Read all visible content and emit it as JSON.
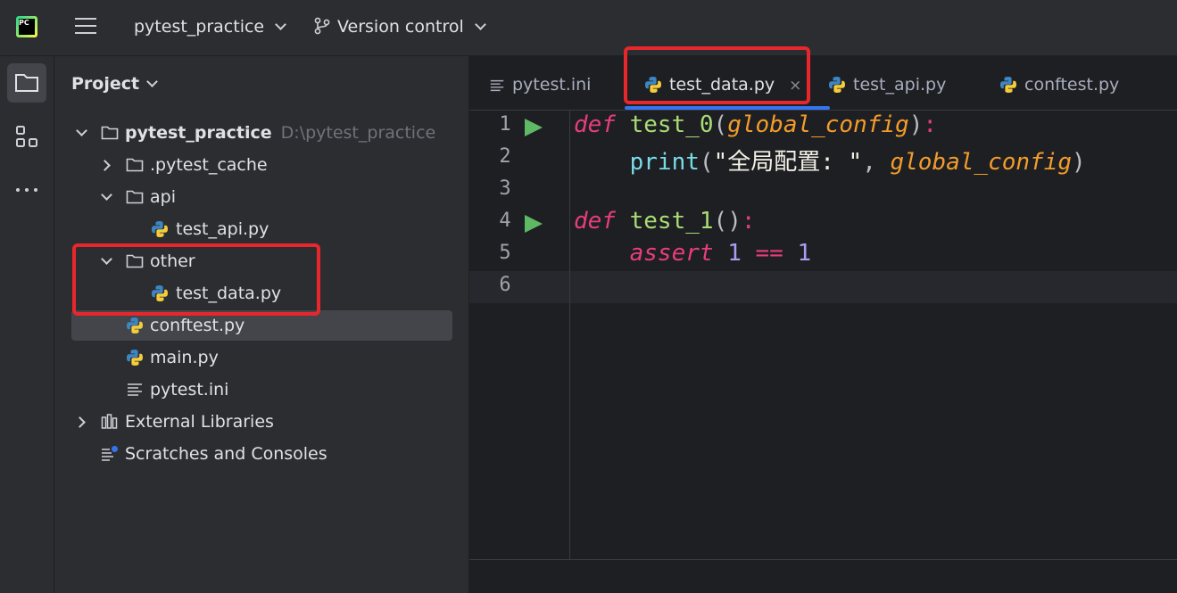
{
  "app": {
    "logo_text": "PC",
    "project_selector": "pytest_practice",
    "vcs_label": "Version control"
  },
  "project_panel": {
    "title": "Project",
    "tree": [
      {
        "label": "pytest_practice",
        "hint": "D:\\pytest_practice",
        "type": "folder",
        "expanded": true
      },
      {
        "label": ".pytest_cache",
        "type": "folder",
        "expanded": false
      },
      {
        "label": "api",
        "type": "folder",
        "expanded": true
      },
      {
        "label": "test_api.py",
        "type": "python"
      },
      {
        "label": "other",
        "type": "folder",
        "expanded": true
      },
      {
        "label": "test_data.py",
        "type": "python"
      },
      {
        "label": "conftest.py",
        "type": "python",
        "selected": true
      },
      {
        "label": "main.py",
        "type": "python"
      },
      {
        "label": "pytest.ini",
        "type": "text"
      },
      {
        "label": "External Libraries",
        "type": "library",
        "expanded": false
      },
      {
        "label": "Scratches and Consoles",
        "type": "scratch"
      }
    ]
  },
  "editor": {
    "tabs": [
      {
        "label": "pytest.ini",
        "type": "text"
      },
      {
        "label": "test_data.py",
        "type": "python",
        "active": true,
        "close": "×"
      },
      {
        "label": "test_api.py",
        "type": "python"
      },
      {
        "label": "conftest.py",
        "type": "python"
      }
    ],
    "line_numbers": [
      "1",
      "2",
      "3",
      "4",
      "5",
      "6"
    ],
    "code": {
      "l1_def": "def",
      "l1_fn": "test_0",
      "l1_open": "(",
      "l1_param": "global_config",
      "l1_close": ")",
      "l1_colon": ":",
      "l2_indent": "    ",
      "l2_builtin": "print",
      "l2_open": "(",
      "l2_str": "\"全局配置: \"",
      "l2_comma": ", ",
      "l2_param": "global_config",
      "l2_close": ")",
      "l4_def": "def",
      "l4_fn": "test_1",
      "l4_parens": "()",
      "l4_colon": ":",
      "l5_indent": "    ",
      "l5_kw": "assert",
      "l5_num1": "1",
      "l5_op": "==",
      "l5_num2": "1"
    }
  },
  "colors": {
    "highlight_box": "#e8272c",
    "active_tab_underline": "#3574f0",
    "run_gutter": "#5fb865"
  }
}
